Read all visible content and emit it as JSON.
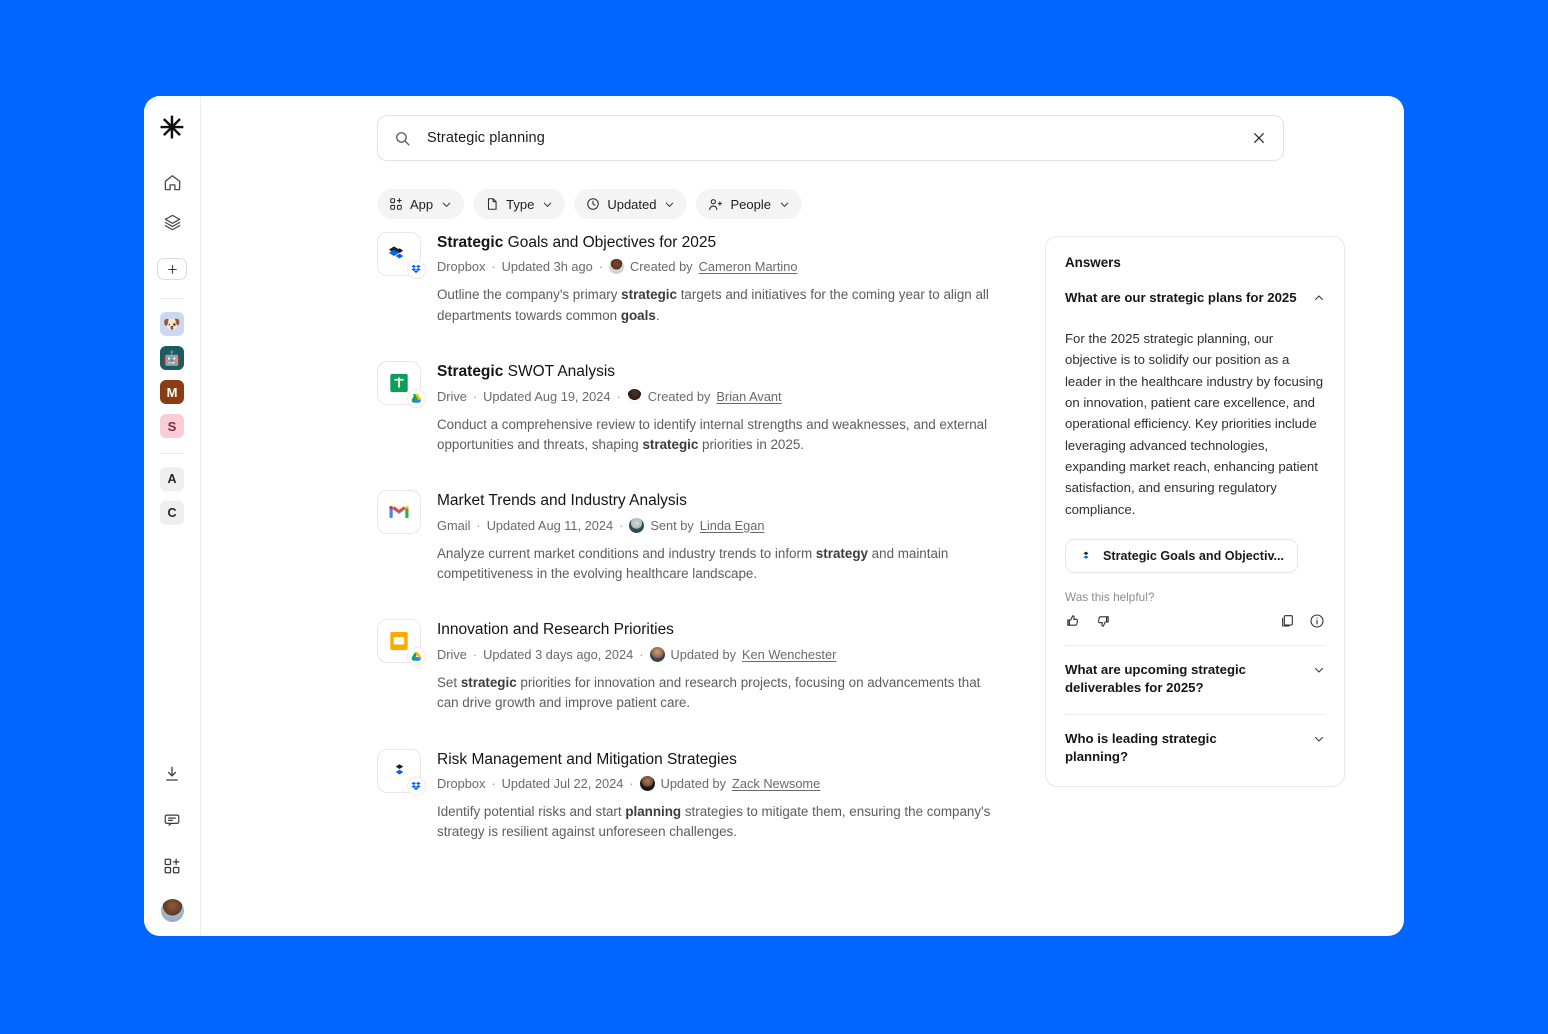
{
  "theme": {
    "background": "#0066ff",
    "surface": "#ffffff",
    "accent": "#0061ff"
  },
  "sidebar": {
    "logo": "asterisk-logo",
    "nav": [
      {
        "name": "home",
        "label": "Home"
      },
      {
        "name": "layers",
        "label": "Collections"
      }
    ],
    "add_label": "+",
    "apps": [
      {
        "name": "dog-app",
        "glyph": "🐶",
        "bg": "#ccd8f0"
      },
      {
        "name": "robot-app",
        "glyph": "🤖",
        "bg": "#1d5b63"
      },
      {
        "name": "gmail-app",
        "glyph": "M",
        "bg": "#8a3d12",
        "fg": "#ffffff"
      },
      {
        "name": "slack-app",
        "glyph": "S",
        "bg": "#f9ccd6",
        "fg": "#7d2a4d"
      }
    ],
    "letters": [
      {
        "name": "a-tile",
        "glyph": "A"
      },
      {
        "name": "c-tile",
        "glyph": "C"
      }
    ],
    "bottom": [
      {
        "name": "download",
        "label": "Download"
      },
      {
        "name": "feedback",
        "label": "Feedback"
      },
      {
        "name": "add-app",
        "label": "Add app"
      }
    ]
  },
  "search": {
    "value": "Strategic planning",
    "placeholder": "Search",
    "clear_label": "Clear"
  },
  "filters": [
    {
      "name": "app",
      "label": "App",
      "icon": "apps-icon"
    },
    {
      "name": "type",
      "label": "Type",
      "icon": "file-icon"
    },
    {
      "name": "updated",
      "label": "Updated",
      "icon": "clock-icon"
    },
    {
      "name": "people",
      "label": "People",
      "icon": "people-icon"
    }
  ],
  "results": [
    {
      "icon": "dropbox-file-icon",
      "badge": "dropbox-badge",
      "title_bold": "Strategic",
      "title_rest": " Goals and Objectives for 2025",
      "source": "Dropbox",
      "updated": "Updated 3h ago",
      "attribution": "Created by",
      "person": "Cameron Martino",
      "snippet_parts": [
        {
          "t": "Outline the company's primary ",
          "b": false
        },
        {
          "t": "strategic",
          "b": true
        },
        {
          "t": " targets and initiatives for the coming year to align all departments towards common ",
          "b": false
        },
        {
          "t": "goals",
          "b": true
        },
        {
          "t": ".",
          "b": false
        }
      ]
    },
    {
      "icon": "google-sheets-icon",
      "badge": "google-drive-badge",
      "title_bold": "Strategic",
      "title_rest": " SWOT Analysis",
      "source": "Drive",
      "updated": "Updated Aug 19, 2024",
      "attribution": "Created by",
      "person": "Brian Avant",
      "snippet_parts": [
        {
          "t": "Conduct a comprehensive review to identify internal strengths and weaknesses, and external opportunities and threats, shaping ",
          "b": false
        },
        {
          "t": "strategic",
          "b": true
        },
        {
          "t": " priorities in 2025.",
          "b": false
        }
      ]
    },
    {
      "icon": "gmail-icon",
      "badge": "",
      "title_bold": "",
      "title_rest": "Market Trends and Industry Analysis",
      "source": "Gmail",
      "updated": "Updated Aug 11, 2024",
      "attribution": "Sent by",
      "person": "Linda Egan",
      "snippet_parts": [
        {
          "t": "Analyze current market conditions and industry trends to inform ",
          "b": false
        },
        {
          "t": "strategy",
          "b": true
        },
        {
          "t": " and maintain competitiveness in the evolving healthcare landscape.",
          "b": false
        }
      ]
    },
    {
      "icon": "google-slides-icon",
      "badge": "google-drive-badge",
      "title_bold": "",
      "title_rest": "Innovation and Research Priorities",
      "source": "Drive",
      "updated": "Updated 3 days ago, 2024",
      "attribution": "Updated by",
      "person": "Ken Wenchester",
      "snippet_parts": [
        {
          "t": "Set ",
          "b": false
        },
        {
          "t": "strategic",
          "b": true
        },
        {
          "t": " priorities for innovation and research projects, focusing on advancements that can drive growth and improve patient care.",
          "b": false
        }
      ]
    },
    {
      "icon": "dropbox-file-icon",
      "badge": "dropbox-badge",
      "title_bold": "",
      "title_rest": "Risk Management and Mitigation Strategies",
      "source": "Dropbox",
      "updated": "Updated Jul 22, 2024",
      "attribution": "Updated by",
      "person": "Zack Newsome",
      "snippet_parts": [
        {
          "t": "Identify potential risks and start ",
          "b": false
        },
        {
          "t": "planning",
          "b": true
        },
        {
          "t": " strategies to mitigate them, ensuring the company's strategy is resilient against unforeseen challenges.",
          "b": false
        }
      ]
    }
  ],
  "answers": {
    "heading": "Answers",
    "question": "What are our strategic plans for 2025",
    "body": "For the 2025 strategic planning, our objective is to solidify our position as a leader in the healthcare industry by focusing on innovation, patient care excellence, and operational efficiency. Key priorities include leveraging advanced technologies, expanding market reach, enhancing patient satisfaction, and ensuring regulatory compliance.",
    "source_chip": "Strategic Goals and Objectiv...",
    "helpful_label": "Was this helpful?",
    "actions": [
      {
        "name": "thumbs-up",
        "label": "Helpful"
      },
      {
        "name": "thumbs-down",
        "label": "Not helpful"
      },
      {
        "name": "copy",
        "label": "Copy"
      },
      {
        "name": "info",
        "label": "Info"
      }
    ],
    "followups": [
      {
        "q": "What are upcoming strategic deliverables for 2025?"
      },
      {
        "q": "Who is leading strategic planning?"
      }
    ]
  }
}
